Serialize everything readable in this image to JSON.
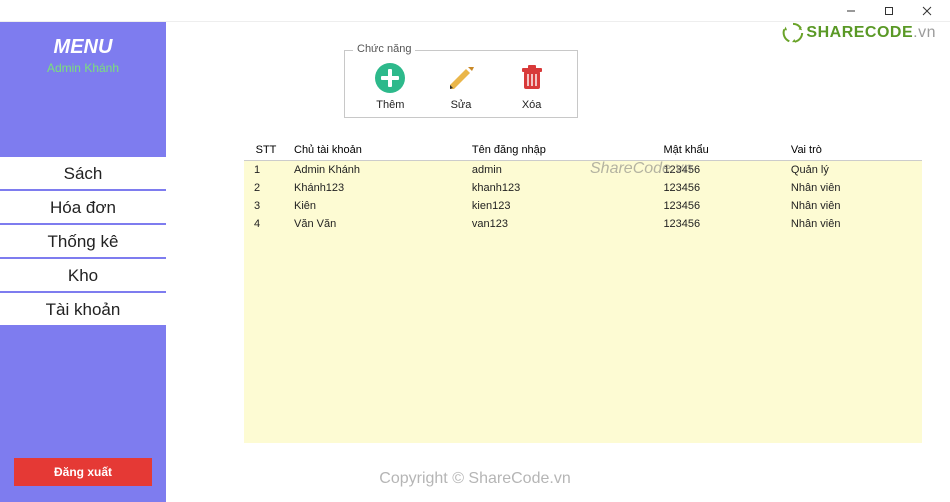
{
  "window": {},
  "logo": {
    "a": "SHARECODE",
    "b": ".vn"
  },
  "sidebar": {
    "title": "MENU",
    "user": "Admin Khánh",
    "items": [
      {
        "label": "Sách"
      },
      {
        "label": "Hóa đơn"
      },
      {
        "label": "Thống kê"
      },
      {
        "label": "Kho"
      },
      {
        "label": "Tài khoản"
      }
    ],
    "logout_label": "Đăng xuất"
  },
  "toolbar": {
    "legend": "Chức năng",
    "add_label": "Thêm",
    "edit_label": "Sửa",
    "delete_label": "Xóa"
  },
  "table": {
    "headers": {
      "stt": "STT",
      "owner": "Chủ tài khoản",
      "login": "Tên đăng nhập",
      "password": "Mật khẩu",
      "role": "Vai trò"
    },
    "rows": [
      {
        "stt": "1",
        "owner": "Admin Khánh",
        "login": "admin",
        "password": "123456",
        "role": "Quản lý"
      },
      {
        "stt": "2",
        "owner": "Khánh123",
        "login": "khanh123",
        "password": "123456",
        "role": "Nhân viên"
      },
      {
        "stt": "3",
        "owner": "Kiên",
        "login": "kien123",
        "password": "123456",
        "role": "Nhân viên"
      },
      {
        "stt": "4",
        "owner": "Văn Văn",
        "login": "van123",
        "password": "123456",
        "role": "Nhân viên"
      }
    ]
  },
  "watermark": {
    "a": "ShareCode.vn",
    "b": "Copyright © ShareCode.vn"
  }
}
